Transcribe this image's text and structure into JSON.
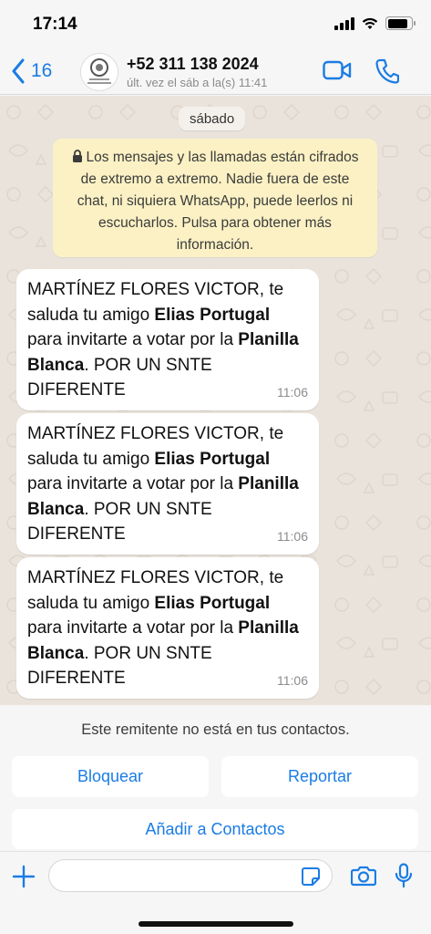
{
  "status_bar": {
    "time": "17:14",
    "battery_level": 0.85
  },
  "header": {
    "back_count": "16",
    "contact_name": "+52 311 138 2024",
    "contact_status": "últ. vez el sáb a la(s) 11:41",
    "icons": [
      "chevron-left-icon",
      "video-icon",
      "phone-icon"
    ]
  },
  "chat": {
    "date_chip": "sábado",
    "encryption_notice": "Los mensajes y las llamadas están cifrados de extremo a extremo. Nadie fuera de este chat, ni siquiera WhatsApp, puede leerlos ni escucharlos. Pulsa para obtener más información.",
    "messages": [
      {
        "part1": "MARTÍNEZ FLORES VICTOR, te saluda tu amigo ",
        "bold1": "Elias Portugal",
        "part2": " para invitarte a votar por la ",
        "bold2": "Planilla Blanca",
        "part3": ". POR UN SNTE DIFERENTE",
        "time": "11:06"
      },
      {
        "part1": "MARTÍNEZ FLORES VICTOR, te saluda tu amigo ",
        "bold1": "Elias Portugal",
        "part2": " para invitarte a votar por la ",
        "bold2": "Planilla Blanca",
        "part3": ". POR UN SNTE DIFERENTE",
        "time": "11:06"
      },
      {
        "part1": "MARTÍNEZ FLORES VICTOR, te saluda tu amigo ",
        "bold1": "Elias Portugal",
        "part2": " para invitarte a votar por la ",
        "bold2": "Planilla Blanca",
        "part3": ". POR UN SNTE DIFERENTE",
        "time": "11:06"
      }
    ]
  },
  "bottom": {
    "unknown_sender_notice": "Este remitente no está en tus contactos.",
    "block_label": "Bloquear",
    "report_label": "Reportar",
    "add_contact_label": "Añadir a Contactos"
  },
  "input": {
    "placeholder": ""
  },
  "colors": {
    "accent": "#1a7ce4",
    "chat_background": "#e9e3db",
    "notice_background": "#fbf1c4",
    "bubble": "#ffffff"
  }
}
